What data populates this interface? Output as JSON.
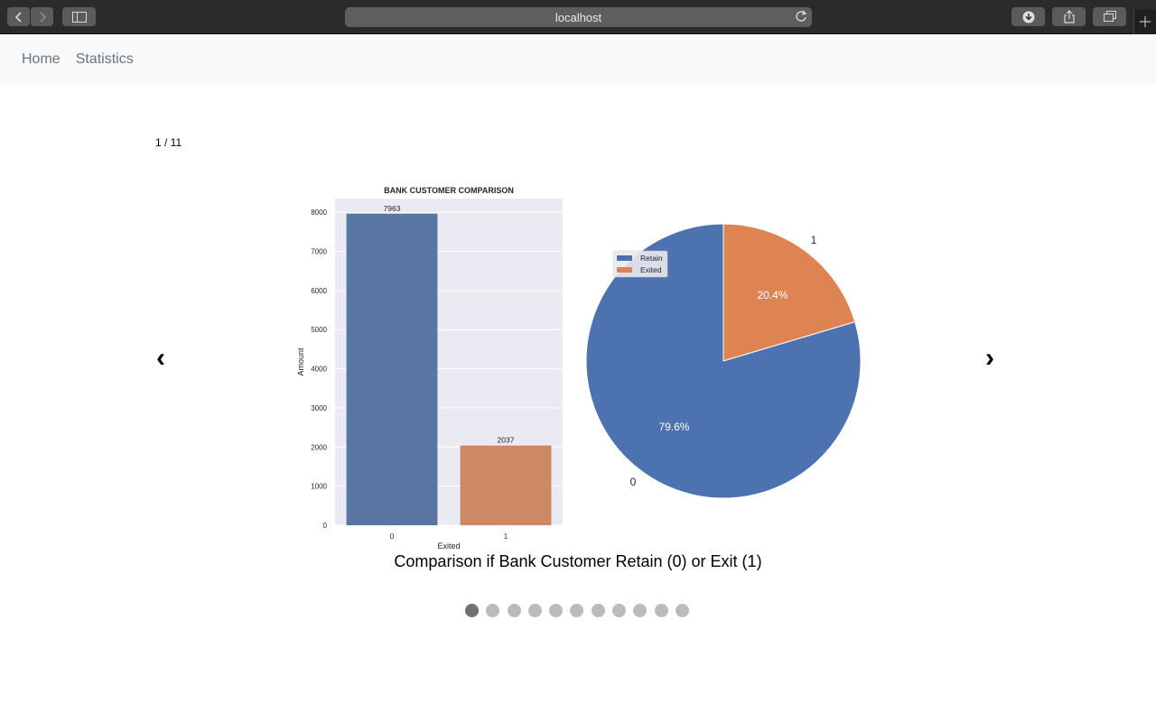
{
  "browser": {
    "url": "localhost"
  },
  "navbar": {
    "links": [
      "Home",
      "Statistics"
    ]
  },
  "carousel": {
    "counter": "1 / 11",
    "prev_glyph": "‹",
    "next_glyph": "›",
    "caption": "Comparison if Bank Customer Retain (0) or Exit (1)",
    "total_slides": 11,
    "active_slide": 1
  },
  "chart_data": [
    {
      "type": "bar",
      "title": "BANK CUSTOMER COMPARISON",
      "categories": [
        "0",
        "1"
      ],
      "values": [
        7963,
        2037
      ],
      "data_labels": [
        "7963",
        "2037"
      ],
      "colors": [
        "#5975a4",
        "#cc8963"
      ],
      "xlabel": "Exited",
      "ylabel": "Amount",
      "ylim": [
        0,
        8350
      ],
      "yticks": [
        0,
        1000,
        2000,
        3000,
        4000,
        5000,
        6000,
        7000,
        8000
      ],
      "grid": true
    },
    {
      "type": "pie",
      "labels": [
        "0",
        "1"
      ],
      "values": [
        79.6,
        20.4
      ],
      "pct_labels": [
        "79.6%",
        "20.4%"
      ],
      "colors": [
        "#4c72b0",
        "#dd8452"
      ],
      "legend": [
        "Retain",
        "Exited"
      ],
      "legend_position": "upper-left"
    }
  ]
}
